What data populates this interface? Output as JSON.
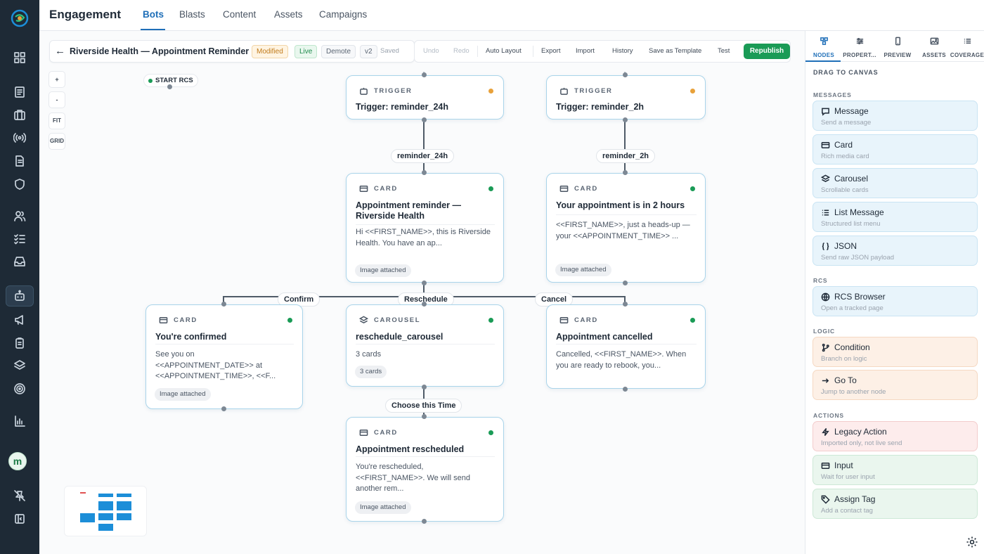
{
  "app": {
    "title": "Engagement"
  },
  "top_tabs": [
    {
      "label": "Bots"
    },
    {
      "label": "Blasts"
    },
    {
      "label": "Content"
    },
    {
      "label": "Assets"
    },
    {
      "label": "Campaigns"
    }
  ],
  "user": {
    "initial": "m"
  },
  "toolbar": {
    "title": "Riverside Health — Appointment Reminder",
    "modified": "Modified",
    "live": "Live",
    "demote": "Demote",
    "version": "v2",
    "saved": "Saved",
    "undo": "Undo",
    "redo": "Redo",
    "auto_layout": "Auto Layout",
    "export": "Export",
    "import": "Import",
    "history": "History",
    "save_template": "Save as Template",
    "test": "Test",
    "republish": "Republish"
  },
  "zoom": {
    "plus": "+",
    "minus": "-",
    "fit": "FIT",
    "grid": "GRID"
  },
  "start": {
    "label": "START RCS"
  },
  "nodes": {
    "trigger1": {
      "type": "TRIGGER",
      "title": "Trigger: reminder_24h"
    },
    "trigger2": {
      "type": "TRIGGER",
      "title": "Trigger: reminder_2h"
    },
    "card1": {
      "type": "CARD",
      "title": "Appointment reminder — Riverside Health",
      "body": "Hi <<FIRST_NAME>>, this is Riverside Health.  You have an ap...",
      "chip": "Image attached"
    },
    "card2": {
      "type": "CARD",
      "title": "Your appointment is in 2 hours",
      "body": "<<FIRST_NAME>>, just a heads-up — your <<APPOINTMENT_TIME>> ...",
      "chip": "Image attached"
    },
    "confirmed": {
      "type": "CARD",
      "title": "You're confirmed",
      "body": "See you on <<APPOINTMENT_DATE>> at <<APPOINTMENT_TIME>>, <<F...",
      "chip": "Image attached"
    },
    "carousel": {
      "type": "CAROUSEL",
      "title": "reschedule_carousel",
      "body": "3 cards",
      "chip": "3 cards"
    },
    "cancelled": {
      "type": "CARD",
      "title": "Appointment cancelled",
      "body": "Cancelled, <<FIRST_NAME>>. When you are ready to rebook, you..."
    },
    "rescheduled": {
      "type": "CARD",
      "title": "Appointment rescheduled",
      "body": "You're rescheduled, <<FIRST_NAME>>. We will send another rem...",
      "chip": "Image attached"
    }
  },
  "edge_labels": {
    "reminder_24h": "reminder_24h",
    "reminder_2h": "reminder_2h",
    "confirm": "Confirm",
    "reschedule": "Reschedule",
    "cancel": "Cancel",
    "choose_time": "Choose this Time"
  },
  "panel": {
    "tabs": [
      {
        "label": "NODES",
        "icon": "nodes-icon"
      },
      {
        "label": "PROPERT...",
        "icon": "sliders-icon"
      },
      {
        "label": "PREVIEW",
        "icon": "phone-icon"
      },
      {
        "label": "ASSETS",
        "icon": "image-icon"
      },
      {
        "label": "COVERAGE",
        "icon": "list-icon"
      }
    ],
    "drag_title": "DRAG TO CANVAS",
    "sections": {
      "messages": "MESSAGES",
      "rcs": "RCS",
      "logic": "LOGIC",
      "actions": "ACTIONS"
    },
    "items": [
      {
        "label": "Message",
        "sub": "Send a message"
      },
      {
        "label": "Card",
        "sub": "Rich media card"
      },
      {
        "label": "Carousel",
        "sub": "Scrollable cards"
      },
      {
        "label": "List Message",
        "sub": "Structured list menu"
      },
      {
        "label": "JSON",
        "sub": "Send raw JSON payload"
      },
      {
        "label": "RCS Browser",
        "sub": "Open a tracked page"
      },
      {
        "label": "Condition",
        "sub": "Branch on logic"
      },
      {
        "label": "Go To",
        "sub": "Jump to another node"
      },
      {
        "label": "Legacy Action",
        "sub": "Imported only, not live send"
      },
      {
        "label": "Input",
        "sub": "Wait for user input"
      },
      {
        "label": "Assign Tag",
        "sub": "Add a contact tag"
      }
    ]
  },
  "colors": {
    "accent": "#1f6fb8",
    "live_green": "#1a9b56",
    "trigger_dot": "#e8a13a",
    "rail": "#1e2a36",
    "minimap_block": "#1c8ed8"
  }
}
